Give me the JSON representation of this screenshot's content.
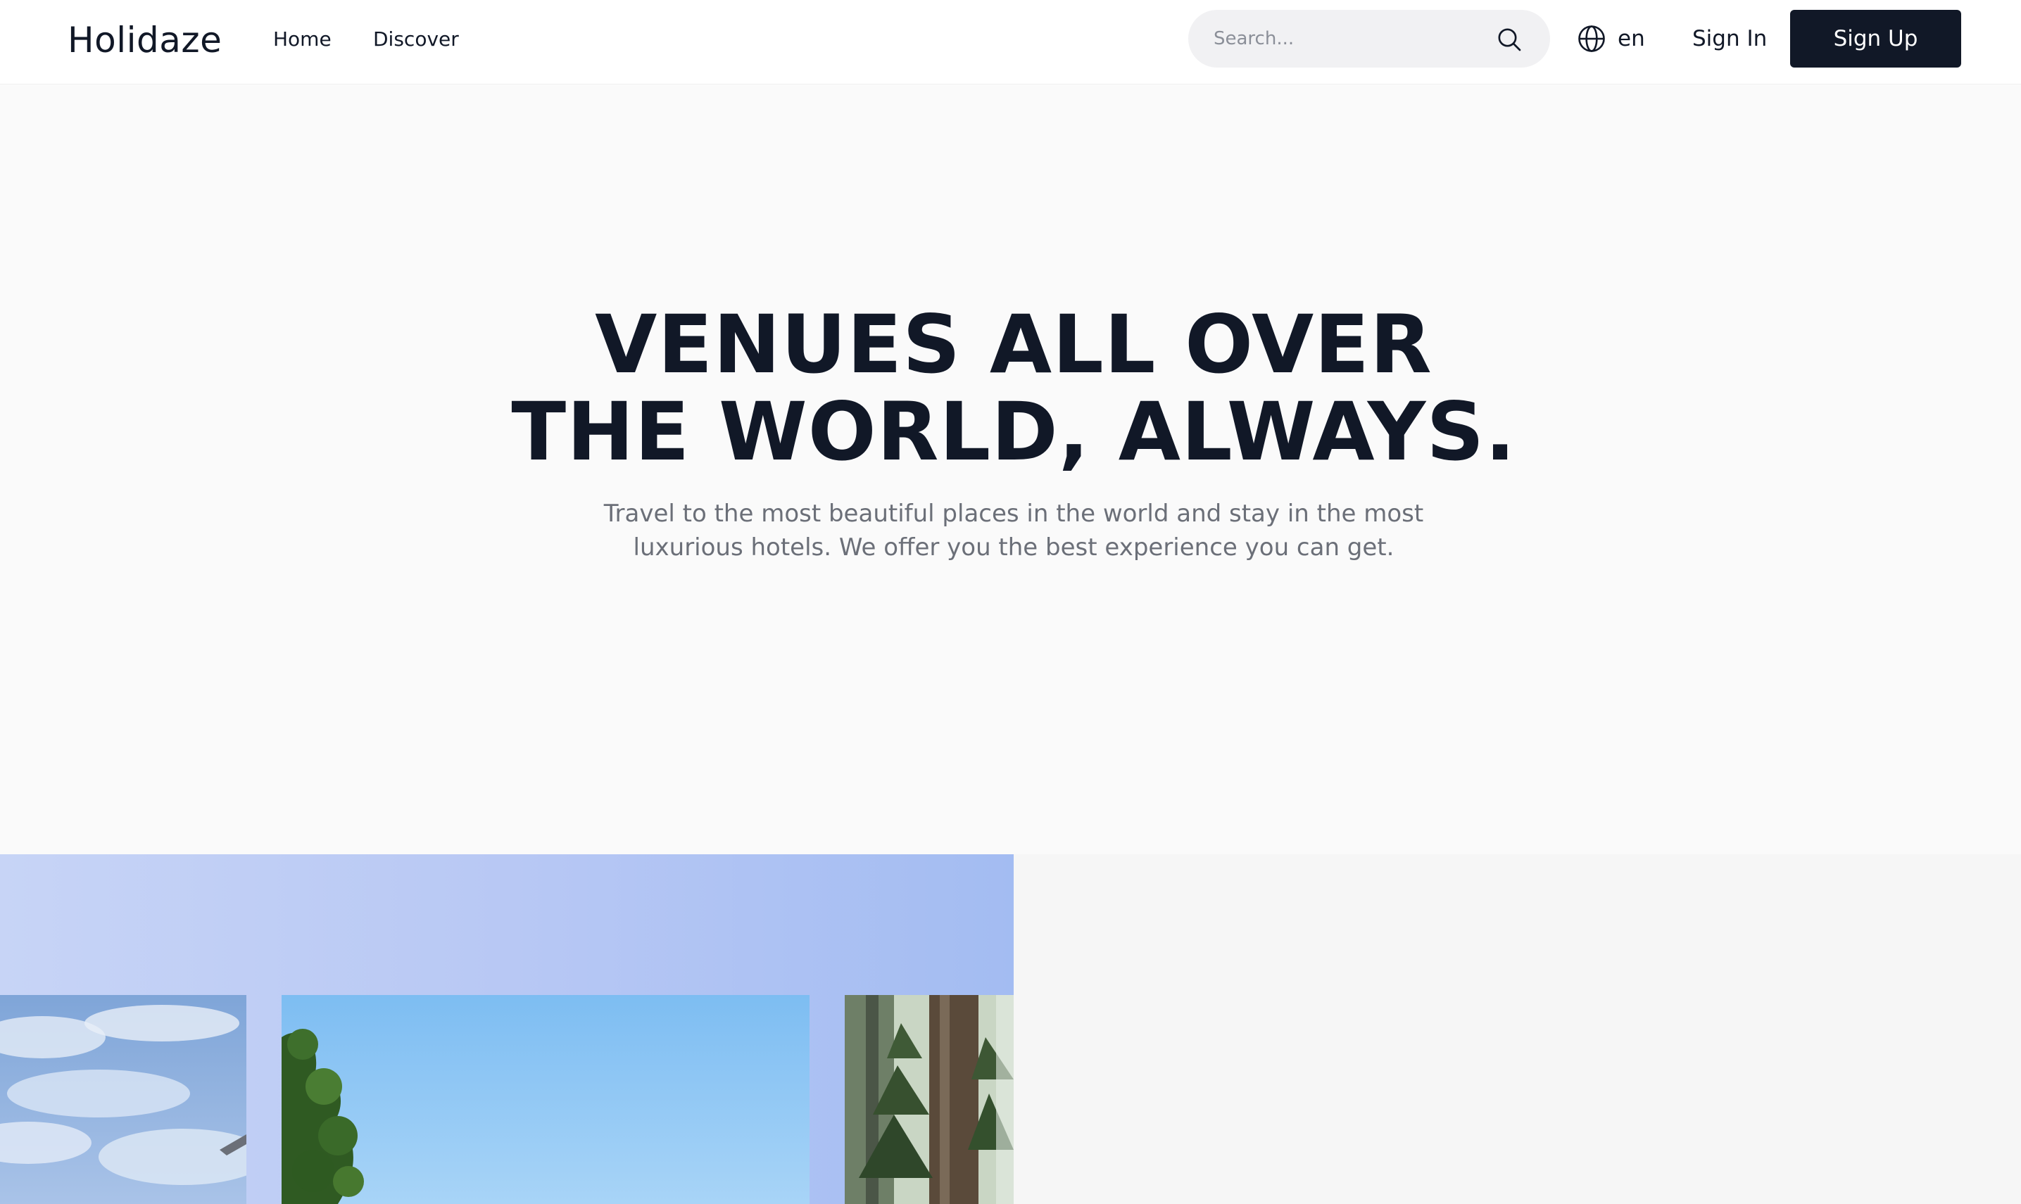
{
  "header": {
    "logo": "Holidaze",
    "nav": {
      "home": "Home",
      "discover": "Discover"
    },
    "search": {
      "placeholder": "Search..."
    },
    "language": {
      "label": "en",
      "icon": "globe-icon"
    },
    "signin_label": "Sign In",
    "signup_label": "Sign Up"
  },
  "hero": {
    "title_line1": "VENUES ALL OVER",
    "title_line2": "THE WORLD, ALWAYS.",
    "subtitle_line1": "Travel to the most beautiful places in the world and stay in the most",
    "subtitle_line2": "luxurious hotels. We offer you the best experience you can get."
  },
  "colors": {
    "primary_dark": "#111827",
    "page_background": "#fafafa",
    "gallery_band": "#b8c8f4"
  }
}
